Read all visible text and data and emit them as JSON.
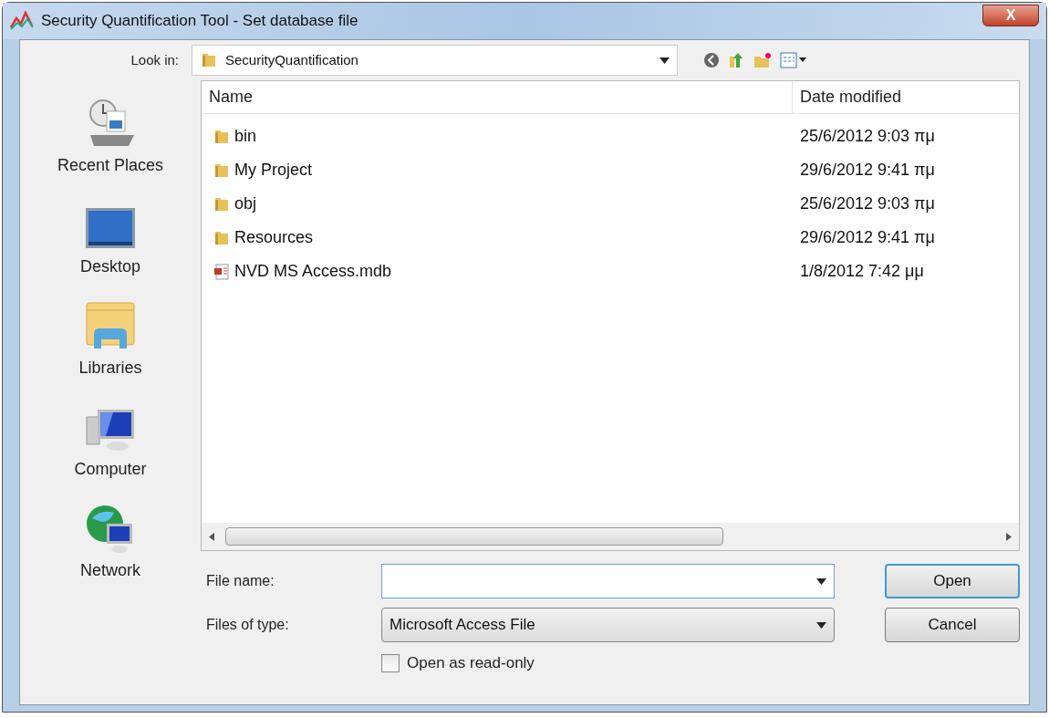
{
  "window": {
    "title": "Security Quantification Tool - Set database file",
    "close": "X"
  },
  "look_in": {
    "label": "Look in:",
    "value": "SecurityQuantification"
  },
  "places": [
    {
      "label": "Recent Places",
      "kind": "recent"
    },
    {
      "label": "Desktop",
      "kind": "desktop"
    },
    {
      "label": "Libraries",
      "kind": "libraries"
    },
    {
      "label": "Computer",
      "kind": "computer"
    },
    {
      "label": "Network",
      "kind": "network"
    }
  ],
  "table": {
    "columns": [
      "Name",
      "Date modified"
    ],
    "rows": [
      {
        "kind": "folder",
        "name": "bin",
        "date": "25/6/2012 9:03 πμ"
      },
      {
        "kind": "folder",
        "name": "My Project",
        "date": "29/6/2012 9:41 πμ"
      },
      {
        "kind": "folder",
        "name": "obj",
        "date": "25/6/2012 9:03 πμ"
      },
      {
        "kind": "folder",
        "name": "Resources",
        "date": "29/6/2012 9:41 πμ"
      },
      {
        "kind": "file",
        "name": "NVD MS Access.mdb",
        "date": "1/8/2012 7:42 μμ"
      }
    ]
  },
  "file_name": {
    "label": "File name:"
  },
  "file_type": {
    "label": "Files of type:",
    "value": "Microsoft Access File"
  },
  "read_only": {
    "label": "Open as read-only",
    "checked": false
  },
  "buttons": [
    {
      "label": "Open",
      "default": true
    },
    {
      "label": "Cancel",
      "default": false
    }
  ]
}
